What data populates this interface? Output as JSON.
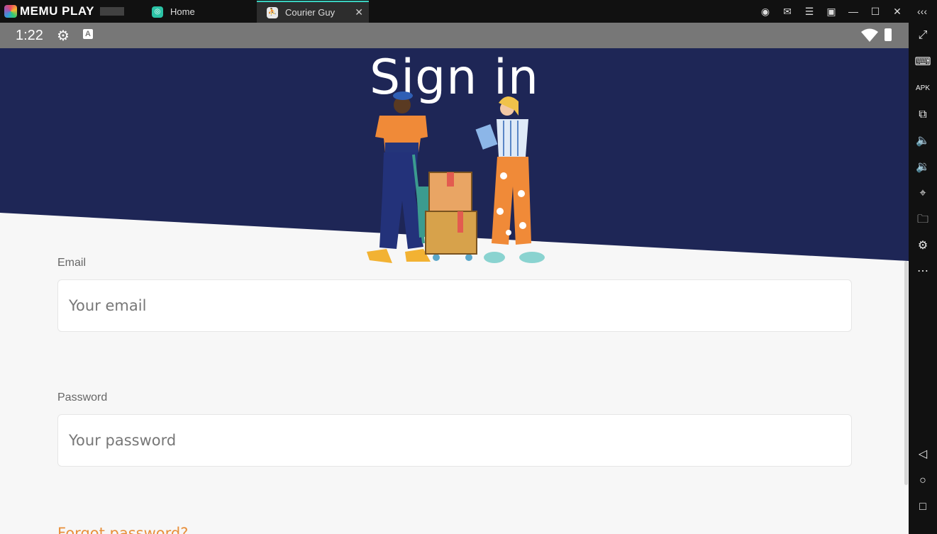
{
  "titlebar": {
    "brand": "MEMU PLAY",
    "tabs": [
      {
        "label": "Home"
      },
      {
        "label": "Courier Guy"
      }
    ]
  },
  "statusbar": {
    "time": "1:22",
    "badge": "A"
  },
  "app": {
    "title": "Sign in",
    "email_label": "Email",
    "email_placeholder": "Your email",
    "password_label": "Password",
    "password_placeholder": "Your password",
    "forgot_link": "Forgot password?"
  },
  "colors": {
    "header_navy": "#1e2656",
    "accent_orange": "#e8903c",
    "tab_accent": "#3ad1c0"
  }
}
